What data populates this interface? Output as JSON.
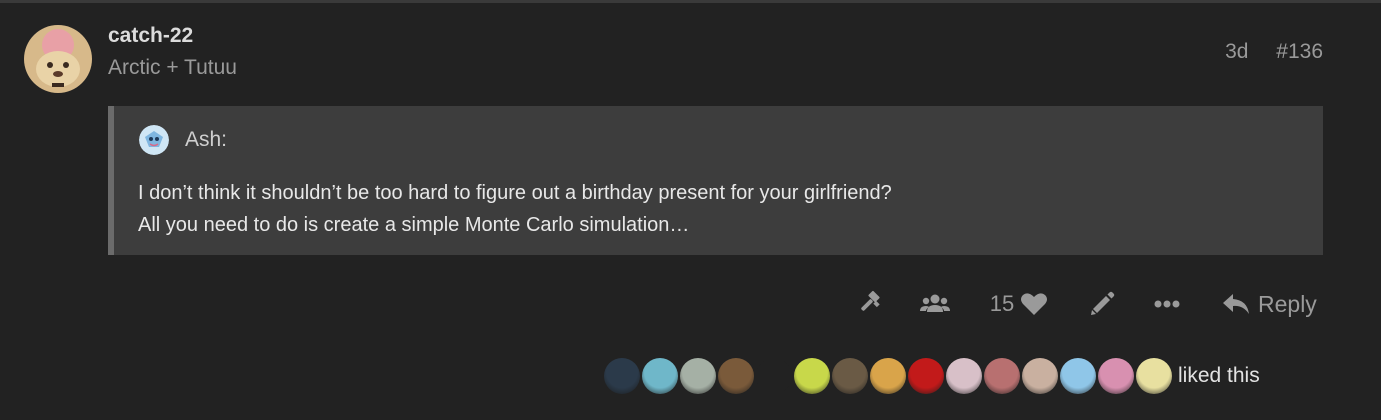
{
  "post": {
    "username": "catch-22",
    "user_title": "Arctic + Tutuu",
    "age": "3d",
    "post_number": "#136"
  },
  "quote": {
    "author": "Ash:",
    "lines": [
      "I don’t think it shouldn’t be too hard to figure out a birthday present for your girlfriend?",
      "All you need to do is create a simple Monte Carlo simulation…"
    ]
  },
  "actions": {
    "like_count": "15",
    "reply_label": "Reply",
    "icons": [
      "gavel-icon",
      "users-icon",
      "heart-icon",
      "pencil-icon",
      "ellipsis-icon",
      "reply-icon"
    ]
  },
  "likers": {
    "label": "liked this",
    "avatar_colors": [
      "#2b3a4a",
      "#6fb7c9",
      "#a5b0a5",
      "#7a5a3a",
      "#3a2a2a",
      "#c8d84a",
      "#6a5a45",
      "#d9a44a",
      "#c21a1a",
      "#d8c0c8",
      "#b87070",
      "#c9b0a0",
      "#8fc6e8",
      "#d890b0",
      "#e8e0a0"
    ]
  },
  "colors": {
    "background": "#222222",
    "quote_bg": "#3d3d3d",
    "muted": "#9a9a9a"
  }
}
